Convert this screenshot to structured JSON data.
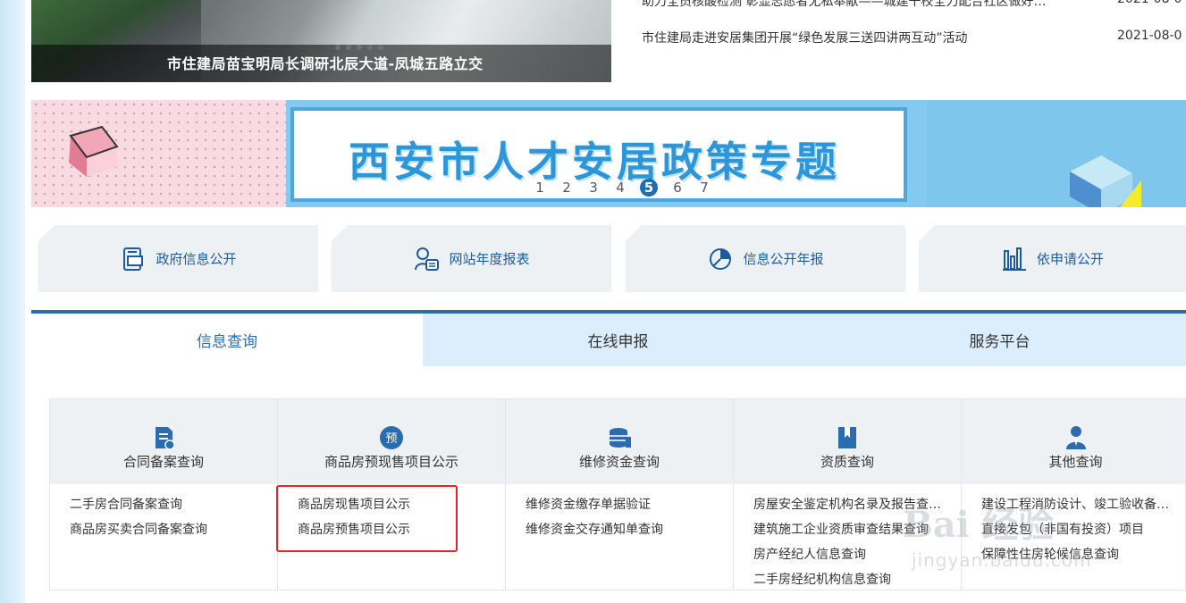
{
  "news": {
    "photo_caption": "市住建局苗宝明局长调研北辰大道-凤城五路立交",
    "items": [
      {
        "title": "助力全员核酸检测 彰显志愿者无私奉献——城建干校全力配合社区做好…",
        "date": "2021-08-0"
      },
      {
        "title": "市住建局走进安居集团开展“绿色发展三送四讲两互动”活动",
        "date": "2021-08-0"
      }
    ]
  },
  "banner": {
    "title": "西安市人才安居政策专题",
    "pages": [
      "1",
      "2",
      "3",
      "4",
      "5",
      "6",
      "7"
    ],
    "current_page": "5"
  },
  "quick_links": [
    {
      "label": "政府信息公开",
      "icon": "document-icon"
    },
    {
      "label": "网站年度报表",
      "icon": "user-report-icon"
    },
    {
      "label": "信息公开年报",
      "icon": "pie-chart-icon"
    },
    {
      "label": "依申请公开",
      "icon": "bar-chart-icon"
    }
  ],
  "tabs": [
    "信息查询",
    "在线申报",
    "服务平台"
  ],
  "active_tab": "信息查询",
  "query": {
    "columns": [
      {
        "label": "合同备案查询",
        "icon": "contract-icon",
        "links": [
          "二手房合同备案查询",
          "商品房买卖合同备案查询"
        ]
      },
      {
        "label": "商品房预现售项目公示",
        "icon": "presale-badge-icon",
        "icon_text": "预",
        "links": [
          "商品房现售项目公示",
          "商品房预售项目公示"
        ]
      },
      {
        "label": "维修资金查询",
        "icon": "coins-icon",
        "links": [
          "维修资金缴存单据验证",
          "维修资金交存通知单查询"
        ]
      },
      {
        "label": "资质查询",
        "icon": "bookmark-icon",
        "links": [
          "房屋安全鉴定机构名录及报告查…",
          "建筑施工企业资质审查结果查询",
          "房产经纪人信息查询",
          "二手房经纪机构信息查询"
        ]
      },
      {
        "label": "其他查询",
        "icon": "person-icon",
        "links": [
          "建设工程消防设计、竣工验收备…",
          "直接发包（非国有投资）项目",
          "保障性住房轮候信息查询"
        ]
      }
    ]
  },
  "watermark": {
    "brand": "Bai 经验",
    "url": "jingyan.baidu.com"
  },
  "colors": {
    "accent": "#2b6cae",
    "tab_inactive": "#dceefc",
    "highlight": "#e4242b",
    "link_blue": "#1d5c9c"
  }
}
